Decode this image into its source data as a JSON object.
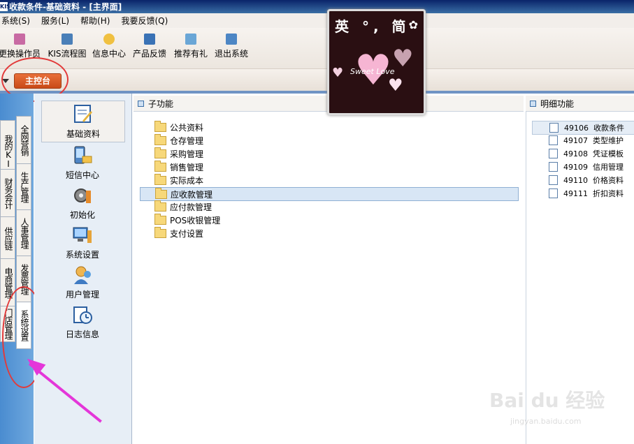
{
  "window": {
    "logo": "KIS",
    "title": "收款条件-基础资料 - [主界面]"
  },
  "menu": [
    "系统(S)",
    "服务(L)",
    "帮助(H)",
    "我要反馈(Q)"
  ],
  "toolbar": {
    "buttons": [
      {
        "label": "更换操作员",
        "icon": "switch-user-icon",
        "color": "#c86aa3"
      },
      {
        "label": "KIS流程图",
        "icon": "flowchart-icon",
        "color": "#4a7fb8"
      },
      {
        "label": "信息中心",
        "icon": "chat-bubble-icon",
        "color": "#f0c040"
      },
      {
        "label": "产品反馈",
        "icon": "document-icon",
        "color": "#3a72b5"
      },
      {
        "label": "推荐有礼",
        "icon": "gift-icon",
        "color": "#6aa6d6"
      },
      {
        "label": "退出系统",
        "icon": "exit-icon",
        "color": "#4d86c4"
      }
    ]
  },
  "main_tab": "主控台",
  "vertical_tabs": {
    "outer": [
      "我的KIS",
      "财务会计",
      "供应链",
      "电商管理",
      "门店管理"
    ],
    "inner": [
      "全网营销",
      "生产管理",
      "人事管理",
      "发票管理",
      "系统设置"
    ]
  },
  "icon_column": [
    {
      "label": "基础资料",
      "icon": "basic-data-icon",
      "selected": true
    },
    {
      "label": "短信中心",
      "icon": "sms-phone-icon"
    },
    {
      "label": "初始化",
      "icon": "initialize-gear-icon"
    },
    {
      "label": "系统设置",
      "icon": "system-settings-icon"
    },
    {
      "label": "用户管理",
      "icon": "user-management-icon"
    },
    {
      "label": "日志信息",
      "icon": "log-clock-icon"
    }
  ],
  "subfunction": {
    "title": "子功能",
    "items": [
      "公共资料",
      "仓存管理",
      "采购管理",
      "销售管理",
      "实际成本",
      "应收款管理",
      "应付款管理",
      "POS收银管理",
      "支付设置"
    ],
    "selected": "应收款管理"
  },
  "detail": {
    "title": "明细功能",
    "items": [
      {
        "code": "49106",
        "name": "收款条件"
      },
      {
        "code": "49107",
        "name": "类型维护"
      },
      {
        "code": "49108",
        "name": "凭证模板"
      },
      {
        "code": "49109",
        "name": "信用管理"
      },
      {
        "code": "49110",
        "name": "价格资料"
      },
      {
        "code": "49111",
        "name": "折扣资料"
      }
    ]
  },
  "overlay": {
    "title": "英 °, 简",
    "caption": "Sweet Love"
  },
  "watermark": {
    "main": "Bai du 经验",
    "url": "jingyan.baidu.com"
  }
}
